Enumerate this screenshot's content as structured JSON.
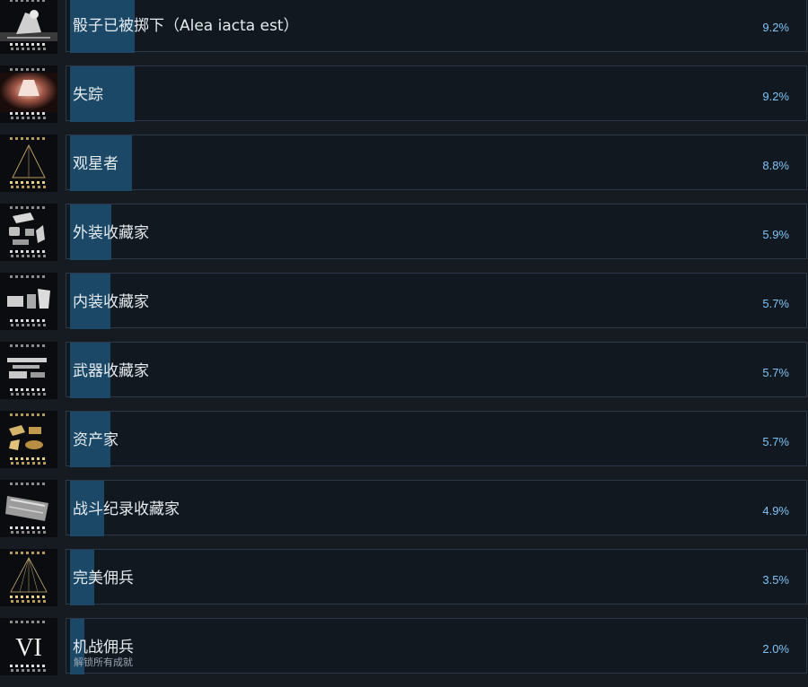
{
  "achievements": [
    {
      "name": "骰子已被掷下（Alea iacta est）",
      "percent": "9.2%",
      "value": 9.2,
      "icon": "mech-fallen-icon"
    },
    {
      "name": "失踪",
      "percent": "9.2%",
      "value": 9.2,
      "icon": "mech-glow-icon"
    },
    {
      "name": "观星者",
      "percent": "8.8%",
      "value": 8.8,
      "icon": "triangle-icon"
    },
    {
      "name": "外装收藏家",
      "percent": "5.9%",
      "value": 5.9,
      "icon": "frame-parts-icon"
    },
    {
      "name": "内装收藏家",
      "percent": "5.7%",
      "value": 5.7,
      "icon": "inner-parts-icon"
    },
    {
      "name": "武器收藏家",
      "percent": "5.7%",
      "value": 5.7,
      "icon": "weapons-icon"
    },
    {
      "name": "资产家",
      "percent": "5.7%",
      "value": 5.7,
      "icon": "gold-assets-icon"
    },
    {
      "name": "战斗纪录收藏家",
      "percent": "4.9%",
      "value": 4.9,
      "icon": "records-icon"
    },
    {
      "name": "完美佣兵",
      "percent": "3.5%",
      "value": 3.5,
      "icon": "gold-triangle-icon"
    },
    {
      "name": "机战佣兵",
      "percent": "2.0%",
      "value": 2.0,
      "icon": "numeral-vi-icon",
      "icon_text": "VI",
      "subtitle": "解锁所有成就"
    }
  ],
  "colors": {
    "background": "#161a21",
    "panel": "#121820",
    "progress_fill": "#1a4866",
    "percent_text": "#7fc3f5"
  }
}
